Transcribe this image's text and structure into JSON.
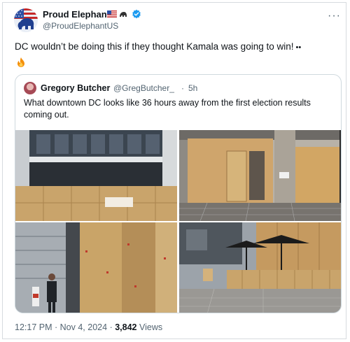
{
  "author": {
    "name": "Proud Elephant",
    "handle": "@ProudElephantUS",
    "name_icons": [
      "us-flag-icon",
      "elephant-icon"
    ],
    "verified": true
  },
  "menu_icon": "more-options-icon",
  "tweet": {
    "text": "DC wouldn’t be doing this if they thought Kamala was going to win!",
    "emoji": [
      "eyes-icon",
      "fire-icon"
    ]
  },
  "quoted": {
    "name": "Gregory Butcher",
    "handle": "@GregButcher_",
    "separator": "·",
    "time": "5h",
    "text": "What downtown DC looks like 36 hours away from the first election results coming out.",
    "photos": [
      "Plywood boarded storefront below building",
      "Boarded entrance with address 750",
      "Boarded columns with man on phone",
      "Boarded patio with black umbrellas"
    ]
  },
  "footer": {
    "time": "12:17 PM",
    "separator1": "·",
    "date": "Nov 4, 2024",
    "separator2": "·",
    "views_count": "3,842",
    "views_label": "Views"
  },
  "colors": {
    "text": "#0f1419",
    "secondary": "#536471",
    "verified": "#1d9bf0",
    "plywood": "#c9a46b",
    "border": "#cfd9de"
  }
}
